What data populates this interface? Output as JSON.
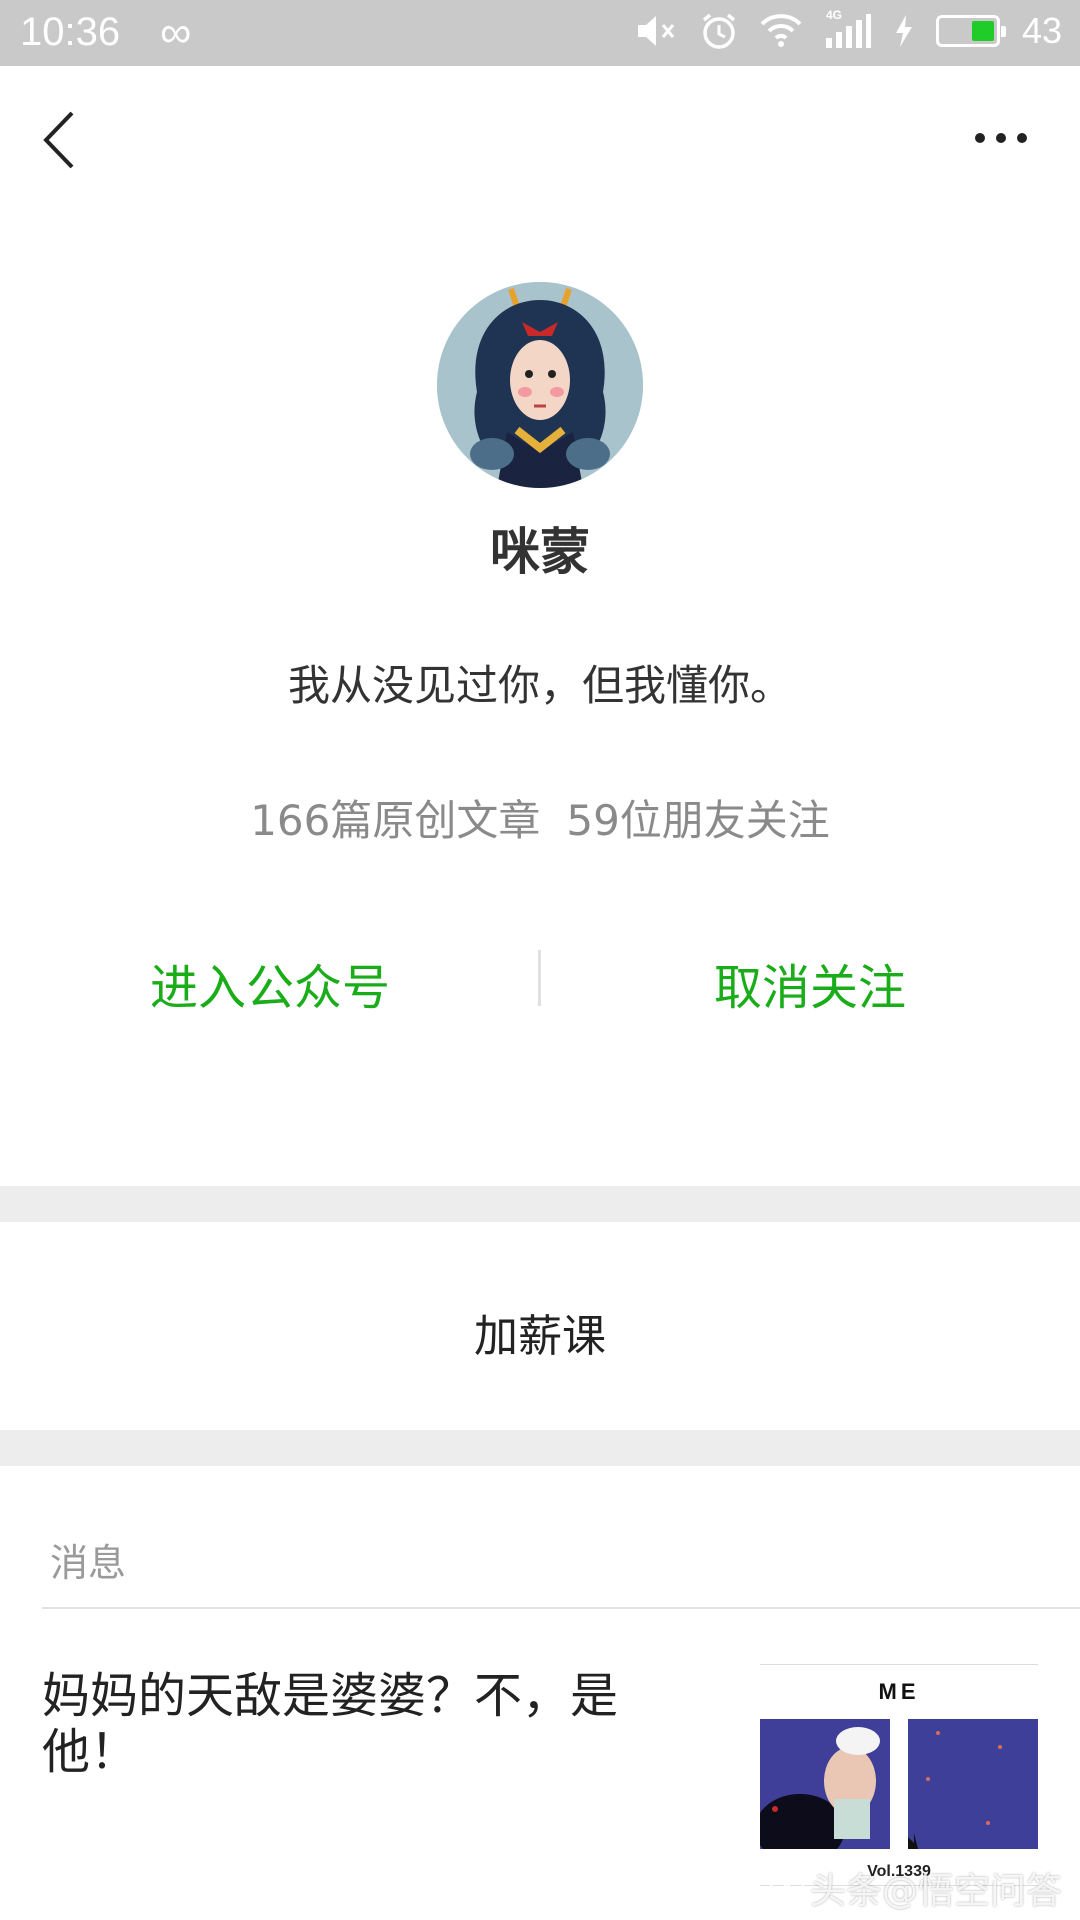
{
  "status_bar": {
    "time": "10:36",
    "infinity_symbol": "∞",
    "network_label": "4G",
    "battery_percent": "43",
    "battery_level": 0.43,
    "icons": [
      "mute-icon",
      "alarm-icon",
      "wifi-icon",
      "signal-icon",
      "charging-icon",
      "battery-icon"
    ]
  },
  "nav": {
    "back_icon": "chevron-left-icon",
    "more_icon": "more-dots-icon"
  },
  "profile": {
    "name": "咪蒙",
    "signature": "我从没见过你，但我懂你。",
    "articles": "166篇原创文章",
    "followers": "59位朋友关注"
  },
  "actions": {
    "enter": "进入公众号",
    "unfollow": "取消关注"
  },
  "menu": {
    "item": "加薪课"
  },
  "messages": {
    "section_label": "消息",
    "article": {
      "title": "妈妈的天敌是婆婆？不，是他！",
      "thumb_header": "ME",
      "thumb_footer": "Vol.1339"
    }
  },
  "watermark": "头条@悟空问答",
  "colors": {
    "accent": "#1aad19",
    "status_bar": "#c9c9c9",
    "band": "#ededed"
  }
}
